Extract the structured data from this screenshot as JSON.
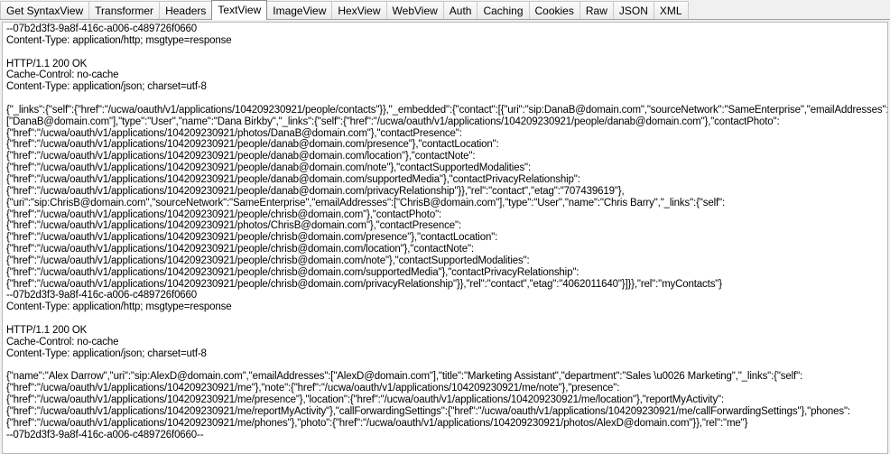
{
  "tabs": [
    {
      "label": "Get SyntaxView",
      "active": false
    },
    {
      "label": "Transformer",
      "active": false
    },
    {
      "label": "Headers",
      "active": false
    },
    {
      "label": "TextView",
      "active": true
    },
    {
      "label": "ImageView",
      "active": false
    },
    {
      "label": "HexView",
      "active": false
    },
    {
      "label": "WebView",
      "active": false
    },
    {
      "label": "Auth",
      "active": false
    },
    {
      "label": "Caching",
      "active": false
    },
    {
      "label": "Cookies",
      "active": false
    },
    {
      "label": "Raw",
      "active": false
    },
    {
      "label": "JSON",
      "active": false
    },
    {
      "label": "XML",
      "active": false
    }
  ],
  "text_lines": [
    "--07b2d3f3-9a8f-416c-a006-c489726f0660",
    "Content-Type: application/http; msgtype=response",
    "",
    "HTTP/1.1 200 OK",
    "Cache-Control: no-cache",
    "Content-Type: application/json; charset=utf-8",
    "",
    "{\"_links\":{\"self\":{\"href\":\"/ucwa/oauth/v1/applications/104209230921/people/contacts\"}},\"_embedded\":{\"contact\":[{\"uri\":\"sip:DanaB@domain.com\",\"sourceNetwork\":\"SameEnterprise\",\"emailAddresses\":",
    "[\"DanaB@domain.com\"],\"type\":\"User\",\"name\":\"Dana Birkby\",\"_links\":{\"self\":{\"href\":\"/ucwa/oauth/v1/applications/104209230921/people/danab@domain.com\"},\"contactPhoto\":",
    "{\"href\":\"/ucwa/oauth/v1/applications/104209230921/photos/DanaB@domain.com\"},\"contactPresence\":",
    "{\"href\":\"/ucwa/oauth/v1/applications/104209230921/people/danab@domain.com/presence\"},\"contactLocation\":",
    "{\"href\":\"/ucwa/oauth/v1/applications/104209230921/people/danab@domain.com/location\"},\"contactNote\":",
    "{\"href\":\"/ucwa/oauth/v1/applications/104209230921/people/danab@domain.com/note\"},\"contactSupportedModalities\":",
    "{\"href\":\"/ucwa/oauth/v1/applications/104209230921/people/danab@domain.com/supportedMedia\"},\"contactPrivacyRelationship\":",
    "{\"href\":\"/ucwa/oauth/v1/applications/104209230921/people/danab@domain.com/privacyRelationship\"}},\"rel\":\"contact\",\"etag\":\"707439619\"},",
    "{\"uri\":\"sip:ChrisB@domain.com\",\"sourceNetwork\":\"SameEnterprise\",\"emailAddresses\":[\"ChrisB@domain.com\"],\"type\":\"User\",\"name\":\"Chris Barry\",\"_links\":{\"self\":",
    "{\"href\":\"/ucwa/oauth/v1/applications/104209230921/people/chrisb@domain.com\"},\"contactPhoto\":",
    "{\"href\":\"/ucwa/oauth/v1/applications/104209230921/photos/ChrisB@domain.com\"},\"contactPresence\":",
    "{\"href\":\"/ucwa/oauth/v1/applications/104209230921/people/chrisb@domain.com/presence\"},\"contactLocation\":",
    "{\"href\":\"/ucwa/oauth/v1/applications/104209230921/people/chrisb@domain.com/location\"},\"contactNote\":",
    "{\"href\":\"/ucwa/oauth/v1/applications/104209230921/people/chrisb@domain.com/note\"},\"contactSupportedModalities\":",
    "{\"href\":\"/ucwa/oauth/v1/applications/104209230921/people/chrisb@domain.com/supportedMedia\"},\"contactPrivacyRelationship\":",
    "{\"href\":\"/ucwa/oauth/v1/applications/104209230921/people/chrisb@domain.com/privacyRelationship\"}},\"rel\":\"contact\",\"etag\":\"4062011640\"}]}},\"rel\":\"myContacts\"}",
    "--07b2d3f3-9a8f-416c-a006-c489726f0660",
    "Content-Type: application/http; msgtype=response",
    "",
    "HTTP/1.1 200 OK",
    "Cache-Control: no-cache",
    "Content-Type: application/json; charset=utf-8",
    "",
    "{\"name\":\"Alex Darrow\",\"uri\":\"sip:AlexD@domain.com\",\"emailAddresses\":[\"AlexD@domain.com\"],\"title\":\"Marketing Assistant\",\"department\":\"Sales \\u0026 Marketing\",\"_links\":{\"self\":",
    "{\"href\":\"/ucwa/oauth/v1/applications/104209230921/me\"},\"note\":{\"href\":\"/ucwa/oauth/v1/applications/104209230921/me/note\"},\"presence\":",
    "{\"href\":\"/ucwa/oauth/v1/applications/104209230921/me/presence\"},\"location\":{\"href\":\"/ucwa/oauth/v1/applications/104209230921/me/location\"},\"reportMyActivity\":",
    "{\"href\":\"/ucwa/oauth/v1/applications/104209230921/me/reportMyActivity\"},\"callForwardingSettings\":{\"href\":\"/ucwa/oauth/v1/applications/104209230921/me/callForwardingSettings\"},\"phones\":",
    "{\"href\":\"/ucwa/oauth/v1/applications/104209230921/me/phones\"},\"photo\":{\"href\":\"/ucwa/oauth/v1/applications/104209230921/photos/AlexD@domain.com\"}},\"rel\":\"me\"}",
    "--07b2d3f3-9a8f-416c-a006-c489726f0660--"
  ]
}
